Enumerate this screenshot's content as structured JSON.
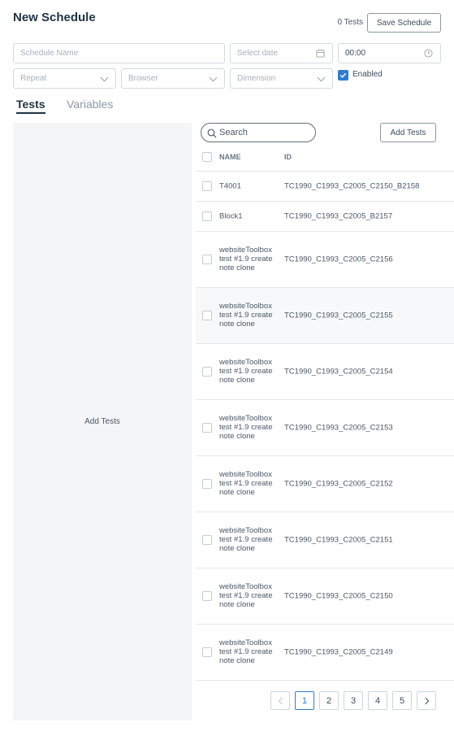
{
  "header": {
    "title": "New Schedule",
    "test_count": "0 Tests",
    "save_label": "Save Schedule"
  },
  "form": {
    "schedule_name_placeholder": "Schedule Name",
    "date_placeholder": "Select date",
    "time_value": "00:00",
    "repeat_placeholder": "Repeat",
    "browser_placeholder": "Browser",
    "dimension_placeholder": "Dimension",
    "enabled_label": "Enabled",
    "enabled_checked": true
  },
  "tabs": [
    {
      "label": "Tests",
      "active": true
    },
    {
      "label": "Variables",
      "active": false
    }
  ],
  "left_panel": {
    "label": "Add Tests"
  },
  "toolbar": {
    "search_placeholder": "Search",
    "add_tests_label": "Add Tests"
  },
  "table": {
    "columns": [
      "NAME",
      "ID"
    ],
    "rows": [
      {
        "name": "T4001",
        "id": "TC1990_C1993_C2005_C2150_B2158"
      },
      {
        "name": "Block1",
        "id": "TC1990_C1993_C2005_B2157"
      },
      {
        "name": "websiteToolbox test #1.9 create note clone",
        "id": "TC1990_C1993_C2005_C2156"
      },
      {
        "name": "websiteToolbox test #1.9 create note clone",
        "id": "TC1990_C1993_C2005_C2155"
      },
      {
        "name": "websiteToolbox test #1.9 create note clone",
        "id": "TC1990_C1993_C2005_C2154"
      },
      {
        "name": "websiteToolbox test #1.9 create note clone",
        "id": "TC1990_C1993_C2005_C2153"
      },
      {
        "name": "websiteToolbox test #1.9 create note clone",
        "id": "TC1990_C1993_C2005_C2152"
      },
      {
        "name": "websiteToolbox test #1.9 create note clone",
        "id": "TC1990_C1993_C2005_C2151"
      },
      {
        "name": "websiteToolbox test #1.9 create note clone",
        "id": "TC1990_C1993_C2005_C2150"
      },
      {
        "name": "websiteToolbox test #1.9 create note clone",
        "id": "TC1990_C1993_C2005_C2149"
      }
    ]
  },
  "pagination": {
    "pages": [
      "1",
      "2",
      "3",
      "4",
      "5"
    ],
    "current": "1"
  },
  "colors": {
    "accent": "#2f7dd1",
    "title": "#1f3344",
    "panel_bg": "#f4f5f6"
  },
  "icons": {
    "date": "calendar-icon",
    "time": "clock-icon",
    "search": "search-icon",
    "dropdown": "chevron-down-icon",
    "prev": "chevron-left-icon",
    "next": "chevron-right-icon",
    "enabled": "checkmark-icon"
  }
}
